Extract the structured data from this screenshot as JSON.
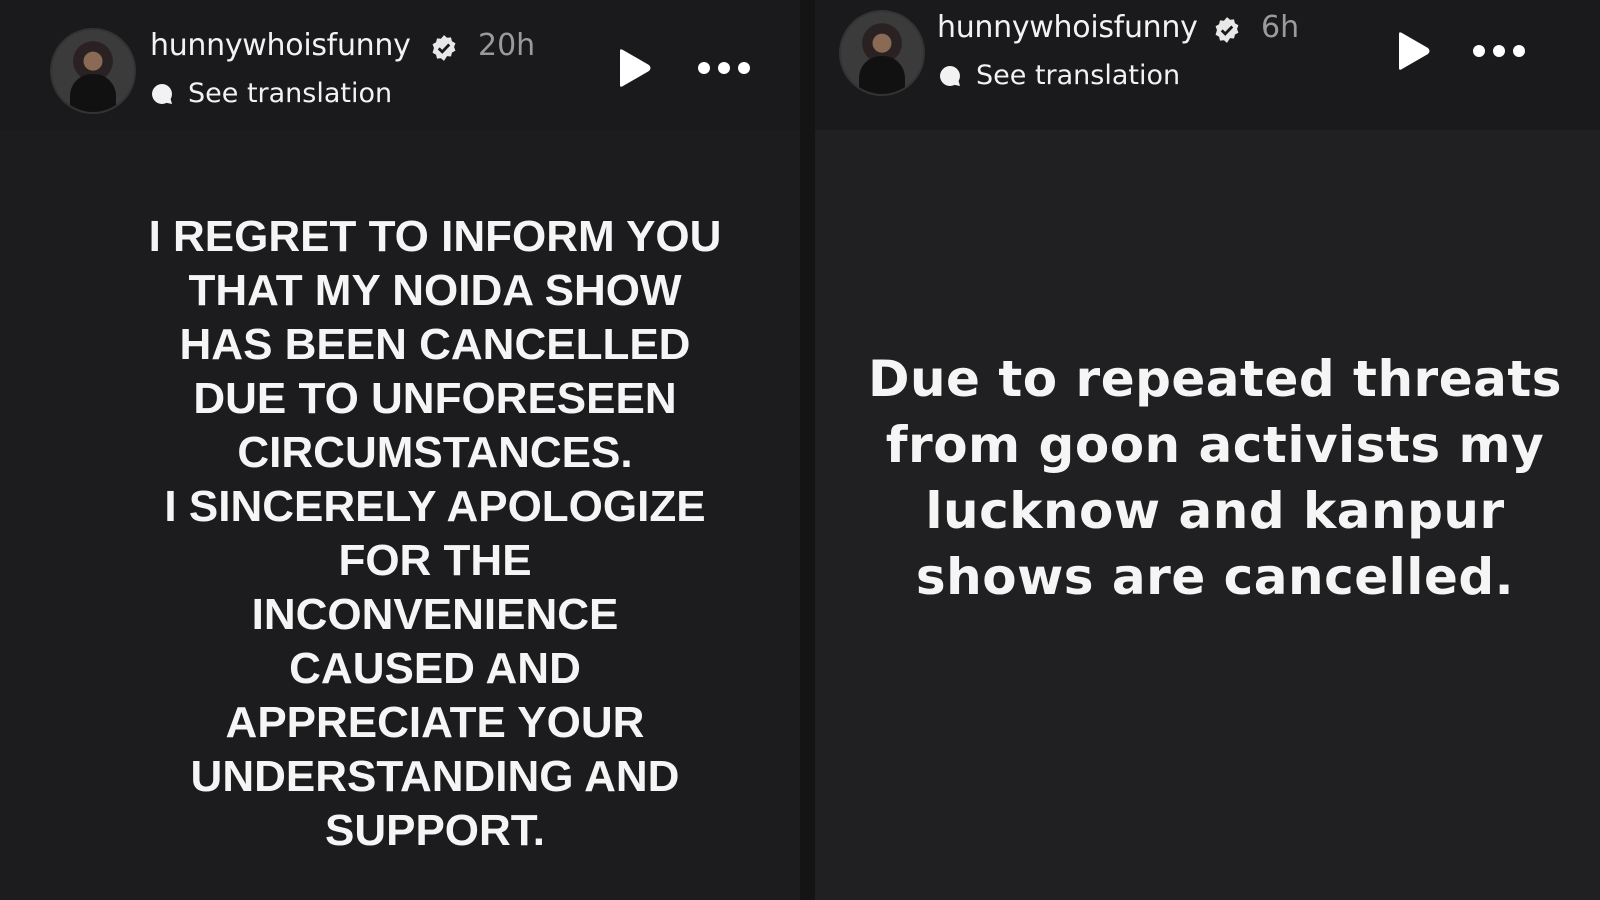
{
  "stories": [
    {
      "username": "hunnywhoisfunny",
      "time": "20h",
      "translate_label": "See translation",
      "message_lines": [
        "I REGRET TO INFORM YOU",
        "THAT MY NOIDA SHOW",
        "HAS BEEN CANCELLED",
        "DUE TO UNFORESEEN",
        "CIRCUMSTANCES.",
        "I SINCERELY APOLOGIZE",
        "FOR THE",
        "INCONVENIENCE",
        "CAUSED AND",
        "APPRECIATE YOUR",
        "UNDERSTANDING AND",
        "SUPPORT."
      ]
    },
    {
      "username": "hunnywhoisfunny",
      "time": "6h",
      "translate_label": "See translation",
      "message_lines": [
        "Due to repeated threats",
        "from goon activists my",
        "lucknow and kanpur",
        "shows are cancelled."
      ]
    }
  ],
  "icons": {
    "verified": "verified-badge-icon",
    "translate": "translate-bubble-icon",
    "play": "play-icon",
    "more": "more-options-icon"
  },
  "colors": {
    "background": "#1c1c1e",
    "text": "#f5f5f5",
    "muted": "#9a9a9a"
  }
}
